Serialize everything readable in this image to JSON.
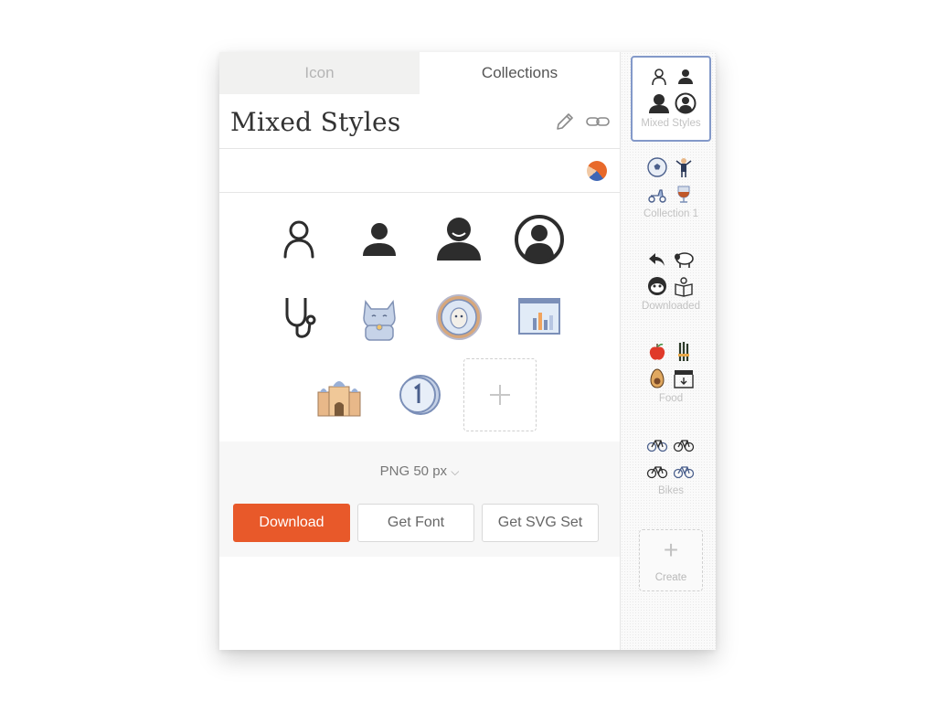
{
  "tabs": {
    "icon": "Icon",
    "collections": "Collections"
  },
  "collection": {
    "title": "Mixed Styles"
  },
  "icons": [
    {
      "name": "user-outline-icon"
    },
    {
      "name": "user-filled-icon"
    },
    {
      "name": "user-round-icon"
    },
    {
      "name": "user-circle-icon"
    },
    {
      "name": "stethoscope-icon"
    },
    {
      "name": "lucky-cat-icon"
    },
    {
      "name": "dog-badge-icon"
    },
    {
      "name": "chart-window-icon"
    },
    {
      "name": "cathedral-icon"
    },
    {
      "name": "coin-one-icon"
    },
    {
      "name": "add-icon"
    }
  ],
  "download": {
    "format": "PNG 50 px",
    "download_label": "Download",
    "font_label": "Get Font",
    "svg_label": "Get SVG Set"
  },
  "sidebar": {
    "collections": [
      {
        "label": "Mixed Styles"
      },
      {
        "label": "Collection 1"
      },
      {
        "label": "Downloaded"
      },
      {
        "label": "Food"
      },
      {
        "label": "Bikes"
      }
    ],
    "create_label": "Create"
  },
  "colors": {
    "accent": "#e8592a",
    "selected_border": "#8399c9",
    "icon_dark": "#2d2d2d"
  }
}
